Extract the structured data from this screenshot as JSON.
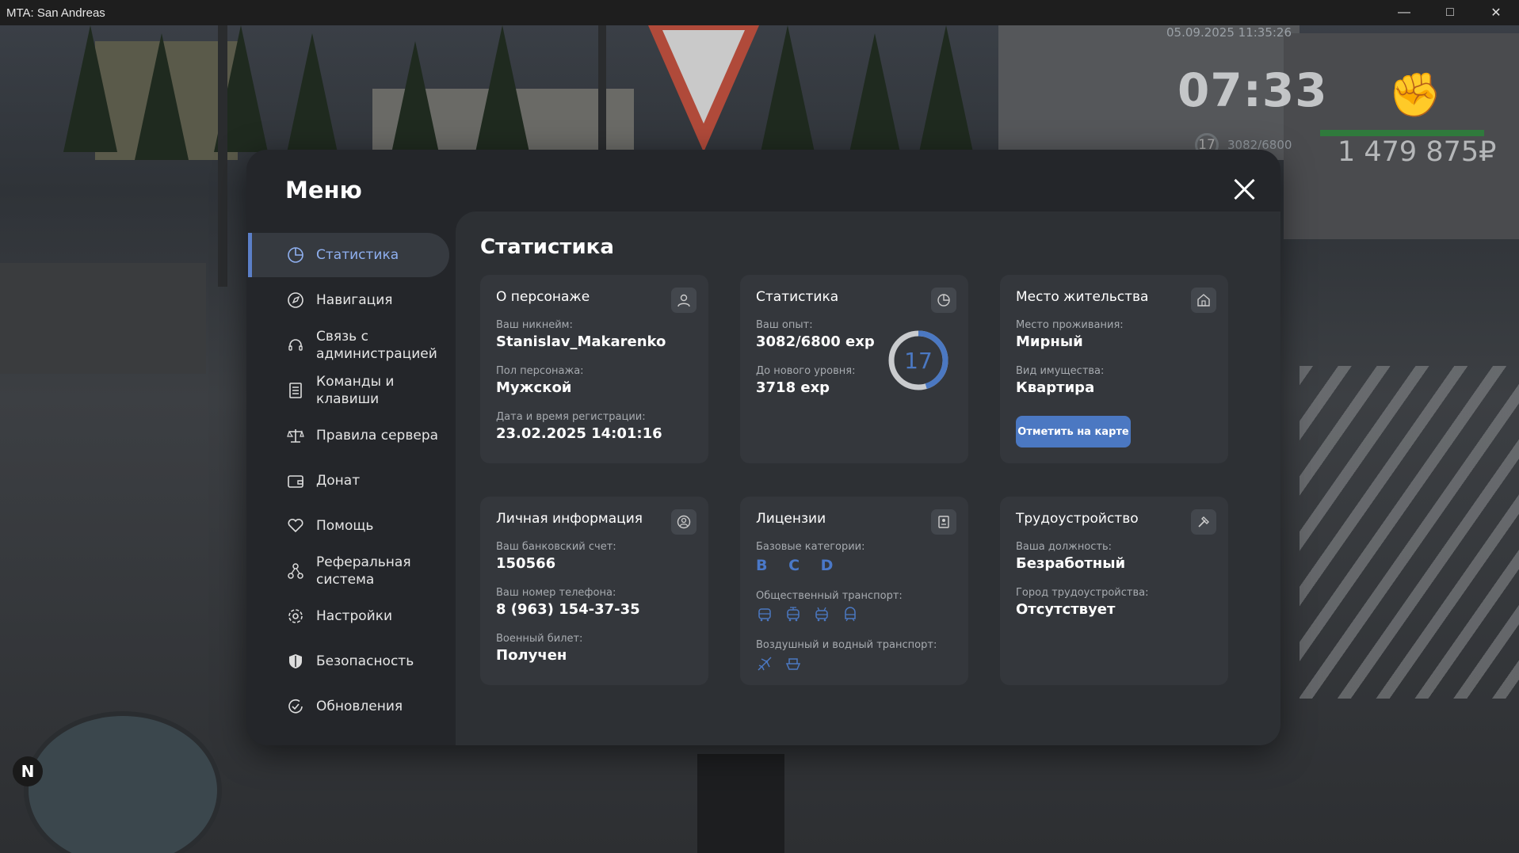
{
  "window": {
    "title": "MTA: San Andreas",
    "minimize_icon": "minimize-icon",
    "maximize_icon": "maximize-icon",
    "close_icon": "close-icon"
  },
  "hud": {
    "datetime": "05.09.2025 11:35:26",
    "time": "07:33",
    "level": "17",
    "exp": "3082/6800",
    "money": "1 479 875₽",
    "health_fraction": 0.95
  },
  "menu": {
    "title": "Меню",
    "nav": [
      {
        "label": "Статистика",
        "icon": "pie-chart-icon",
        "active": true
      },
      {
        "label": "Навигация",
        "icon": "compass-icon",
        "active": false
      },
      {
        "label": "Связь с администрацией",
        "icon": "headset-icon",
        "active": false
      },
      {
        "label": "Команды и клавиши",
        "icon": "list-icon",
        "active": false
      },
      {
        "label": "Правила сервера",
        "icon": "scales-icon",
        "active": false
      },
      {
        "label": "Донат",
        "icon": "wallet-icon",
        "active": false
      },
      {
        "label": "Помощь",
        "icon": "heart-hands-icon",
        "active": false
      },
      {
        "label": "Реферальная система",
        "icon": "network-icon",
        "active": false
      },
      {
        "label": "Настройки",
        "icon": "gear-icon",
        "active": false
      },
      {
        "label": "Безопасность",
        "icon": "shield-icon",
        "active": false
      },
      {
        "label": "Обновления",
        "icon": "refresh-check-icon",
        "active": false
      }
    ]
  },
  "content": {
    "title": "Статистика",
    "character": {
      "title": "О персонаже",
      "icon": "user-icon",
      "nick_label": "Ваш никнейм:",
      "nick": "Stanislav_Makarenko",
      "gender_label": "Пол персонажа:",
      "gender": "Мужской",
      "reg_label": "Дата и время регистрации:",
      "reg": "23.02.2025 14:01:16"
    },
    "stats": {
      "title": "Статистика",
      "icon": "pie-chart-icon",
      "exp_label": "Ваш опыт:",
      "exp": "3082/6800 exp",
      "next_label": "До нового уровня:",
      "next": "3718 exp",
      "level": "17",
      "progress": 0.453
    },
    "residence": {
      "title": "Место жительства",
      "icon": "house-icon",
      "place_label": "Место проживания:",
      "place": "Мирный",
      "property_label": "Вид имущества:",
      "property": "Квартира",
      "map_button": "Отметить на карте"
    },
    "personal": {
      "title": "Личная информация",
      "icon": "user-circle-icon",
      "bank_label": "Ваш банковский счет:",
      "bank": "150566",
      "phone_label": "Ваш номер телефона:",
      "phone": "8 (963) 154-37-35",
      "military_label": "Военный билет:",
      "military": "Получен"
    },
    "licenses": {
      "title": "Лицензии",
      "icon": "id-card-icon",
      "base_label": "Базовые категории:",
      "base": "B C D",
      "public_label": "Общественный транспорт:",
      "public_icons": [
        "bus-icon",
        "tram-icon",
        "trolleybus-icon",
        "metro-icon"
      ],
      "air_label": "Воздушный и водный транспорт:",
      "air_icons": [
        "plane-icon",
        "boat-icon"
      ]
    },
    "employment": {
      "title": "Трудоустройство",
      "icon": "hammer-icon",
      "position_label": "Ваша должность:",
      "position": "Безработный",
      "city_label": "Город трудоустройства:",
      "city": "Отсутствует"
    }
  },
  "colors": {
    "accent": "#4b78c2",
    "active_nav_text": "#8fb0f0",
    "panel": "#24262a",
    "content": "#2d3034",
    "card": "#34373c"
  }
}
